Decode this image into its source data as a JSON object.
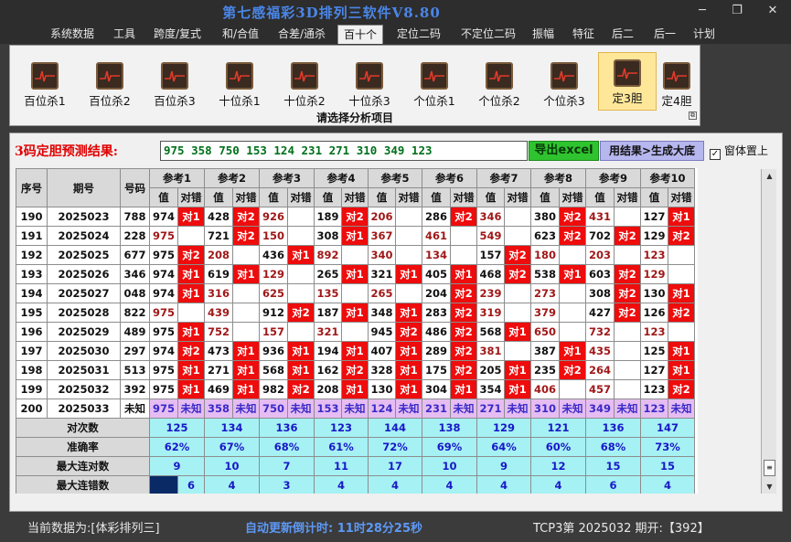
{
  "window": {
    "title": "第七感福彩3D排列三软件V8.80",
    "min": "─",
    "restore": "❐",
    "close": "✕"
  },
  "menu": [
    "系统数据",
    "工具",
    "跨度/复式",
    "和/合值",
    "合差/通杀",
    "百十个",
    "定位二码",
    "不定位二码",
    "振幅",
    "特征",
    "后二",
    "后一",
    "计划"
  ],
  "menu_active": "百十个",
  "toolbar": {
    "items": [
      "百位杀1",
      "百位杀2",
      "百位杀3",
      "十位杀1",
      "十位杀2",
      "十位杀3",
      "个位杀1",
      "个位杀2",
      "个位杀3",
      "定3胆",
      "定4胆"
    ],
    "active": "定3胆",
    "caption": "请选择分析项目",
    "expand_glyph": "⧉"
  },
  "prediction": {
    "label": "3码定胆预测结果:",
    "value": "975 358 750 153 124 231 271 310 349 123",
    "export_label": "导出excel",
    "gen_label": "用结果>生成大底",
    "ontop_label": "窗体置上",
    "ontop_checked": "✓"
  },
  "table": {
    "col_seq": "序号",
    "col_period": "期号",
    "col_num": "号码",
    "refs": [
      "参考1",
      "参考2",
      "参考3",
      "参考4",
      "参考5",
      "参考6",
      "参考7",
      "参考8",
      "参考9",
      "参考10"
    ],
    "sub_val": "值",
    "sub_res": "对错",
    "rows": [
      {
        "seq": "190",
        "period": "2025023",
        "num": "788",
        "cells": [
          [
            "974",
            "对1",
            1
          ],
          [
            "428",
            "对2",
            1
          ],
          [
            "926",
            "",
            0
          ],
          [
            "189",
            "对2",
            1
          ],
          [
            "206",
            "",
            0
          ],
          [
            "286",
            "对2",
            1
          ],
          [
            "346",
            "",
            0
          ],
          [
            "380",
            "对2",
            1
          ],
          [
            "431",
            "",
            0
          ],
          [
            "127",
            "对1",
            1
          ]
        ]
      },
      {
        "seq": "191",
        "period": "2025024",
        "num": "228",
        "cells": [
          [
            "975",
            "",
            0
          ],
          [
            "721",
            "对2",
            1
          ],
          [
            "150",
            "",
            0
          ],
          [
            "308",
            "对1",
            1
          ],
          [
            "367",
            "",
            0
          ],
          [
            "461",
            "",
            0
          ],
          [
            "549",
            "",
            0
          ],
          [
            "623",
            "对2",
            1
          ],
          [
            "702",
            "对2",
            1
          ],
          [
            "129",
            "对2",
            1
          ]
        ]
      },
      {
        "seq": "192",
        "period": "2025025",
        "num": "677",
        "cells": [
          [
            "975",
            "对2",
            1
          ],
          [
            "208",
            "",
            0
          ],
          [
            "436",
            "对1",
            1
          ],
          [
            "892",
            "",
            0
          ],
          [
            "340",
            "",
            0
          ],
          [
            "134",
            "",
            0
          ],
          [
            "157",
            "对2",
            1
          ],
          [
            "180",
            "",
            0
          ],
          [
            "203",
            "",
            0
          ],
          [
            "123",
            "",
            0
          ]
        ]
      },
      {
        "seq": "193",
        "period": "2025026",
        "num": "346",
        "cells": [
          [
            "974",
            "对1",
            1
          ],
          [
            "619",
            "对1",
            1
          ],
          [
            "129",
            "",
            0
          ],
          [
            "265",
            "对1",
            1
          ],
          [
            "321",
            "对1",
            1
          ],
          [
            "405",
            "对1",
            1
          ],
          [
            "468",
            "对2",
            1
          ],
          [
            "538",
            "对1",
            1
          ],
          [
            "603",
            "对2",
            1
          ],
          [
            "129",
            "",
            0
          ]
        ]
      },
      {
        "seq": "194",
        "period": "2025027",
        "num": "048",
        "cells": [
          [
            "974",
            "对1",
            1
          ],
          [
            "316",
            "",
            0
          ],
          [
            "625",
            "",
            0
          ],
          [
            "135",
            "",
            0
          ],
          [
            "265",
            "",
            0
          ],
          [
            "204",
            "对2",
            1
          ],
          [
            "239",
            "",
            0
          ],
          [
            "273",
            "",
            0
          ],
          [
            "308",
            "对2",
            1
          ],
          [
            "130",
            "对1",
            1
          ]
        ]
      },
      {
        "seq": "195",
        "period": "2025028",
        "num": "822",
        "cells": [
          [
            "975",
            "",
            0
          ],
          [
            "439",
            "",
            0
          ],
          [
            "912",
            "对2",
            1
          ],
          [
            "187",
            "对1",
            1
          ],
          [
            "348",
            "对1",
            1
          ],
          [
            "283",
            "对2",
            1
          ],
          [
            "319",
            "",
            0
          ],
          [
            "379",
            "",
            0
          ],
          [
            "427",
            "对2",
            1
          ],
          [
            "126",
            "对2",
            1
          ]
        ]
      },
      {
        "seq": "196",
        "period": "2025029",
        "num": "489",
        "cells": [
          [
            "975",
            "对1",
            1
          ],
          [
            "752",
            "",
            0
          ],
          [
            "157",
            "",
            0
          ],
          [
            "321",
            "",
            0
          ],
          [
            "945",
            "对2",
            1
          ],
          [
            "486",
            "对2",
            1
          ],
          [
            "568",
            "对1",
            1
          ],
          [
            "650",
            "",
            0
          ],
          [
            "732",
            "",
            0
          ],
          [
            "123",
            "",
            0
          ]
        ]
      },
      {
        "seq": "197",
        "period": "2025030",
        "num": "297",
        "cells": [
          [
            "974",
            "对2",
            1
          ],
          [
            "473",
            "对1",
            1
          ],
          [
            "936",
            "对1",
            1
          ],
          [
            "194",
            "对1",
            1
          ],
          [
            "407",
            "对1",
            1
          ],
          [
            "289",
            "对2",
            1
          ],
          [
            "381",
            "",
            0
          ],
          [
            "387",
            "对1",
            1
          ],
          [
            "435",
            "",
            0
          ],
          [
            "125",
            "对1",
            1
          ]
        ]
      },
      {
        "seq": "198",
        "period": "2025031",
        "num": "513",
        "cells": [
          [
            "975",
            "对1",
            1
          ],
          [
            "271",
            "对1",
            1
          ],
          [
            "568",
            "对1",
            1
          ],
          [
            "162",
            "对2",
            1
          ],
          [
            "328",
            "对1",
            1
          ],
          [
            "175",
            "对2",
            1
          ],
          [
            "205",
            "对1",
            1
          ],
          [
            "235",
            "对2",
            1
          ],
          [
            "264",
            "",
            0
          ],
          [
            "127",
            "对1",
            1
          ]
        ]
      },
      {
        "seq": "199",
        "period": "2025032",
        "num": "392",
        "cells": [
          [
            "975",
            "对1",
            1
          ],
          [
            "469",
            "对1",
            1
          ],
          [
            "982",
            "对2",
            1
          ],
          [
            "208",
            "对1",
            1
          ],
          [
            "130",
            "对1",
            1
          ],
          [
            "304",
            "对1",
            1
          ],
          [
            "354",
            "对1",
            1
          ],
          [
            "406",
            "",
            0
          ],
          [
            "457",
            "",
            0
          ],
          [
            "123",
            "对2",
            1
          ]
        ]
      }
    ],
    "unknown_row": {
      "seq": "200",
      "period": "2025033",
      "num": "未知",
      "vals": [
        "975",
        "358",
        "750",
        "153",
        "124",
        "231",
        "271",
        "310",
        "349",
        "123"
      ],
      "res": "未知"
    },
    "stats": [
      {
        "label": "对次数",
        "vals": [
          "125",
          "134",
          "136",
          "123",
          "144",
          "138",
          "129",
          "121",
          "136",
          "147"
        ]
      },
      {
        "label": "准确率",
        "vals": [
          "62%",
          "67%",
          "68%",
          "61%",
          "72%",
          "69%",
          "64%",
          "60%",
          "68%",
          "73%"
        ]
      },
      {
        "label": "最大连对数",
        "vals": [
          "9",
          "10",
          "7",
          "11",
          "17",
          "10",
          "9",
          "12",
          "15",
          "15"
        ]
      },
      {
        "label": "最大连错数",
        "vals": [
          "6",
          "4",
          "3",
          "4",
          "4",
          "4",
          "4",
          "4",
          "6",
          "4"
        ]
      }
    ]
  },
  "statusbar": {
    "current_data": "当前数据为:[体彩排列三]",
    "countdown_label": "自动更新倒计时:",
    "countdown_value": "11时28分25秒",
    "draw_info": "TCP3第 2025032 期开:【392】"
  },
  "colors": {
    "hit": "#ee0c0c",
    "unknown": "#e6bdf2",
    "stats": "#a6f1f4",
    "title": "#4a86e8"
  },
  "scroll": {
    "up": "▲",
    "down": "▼",
    "thumb": "≡"
  }
}
